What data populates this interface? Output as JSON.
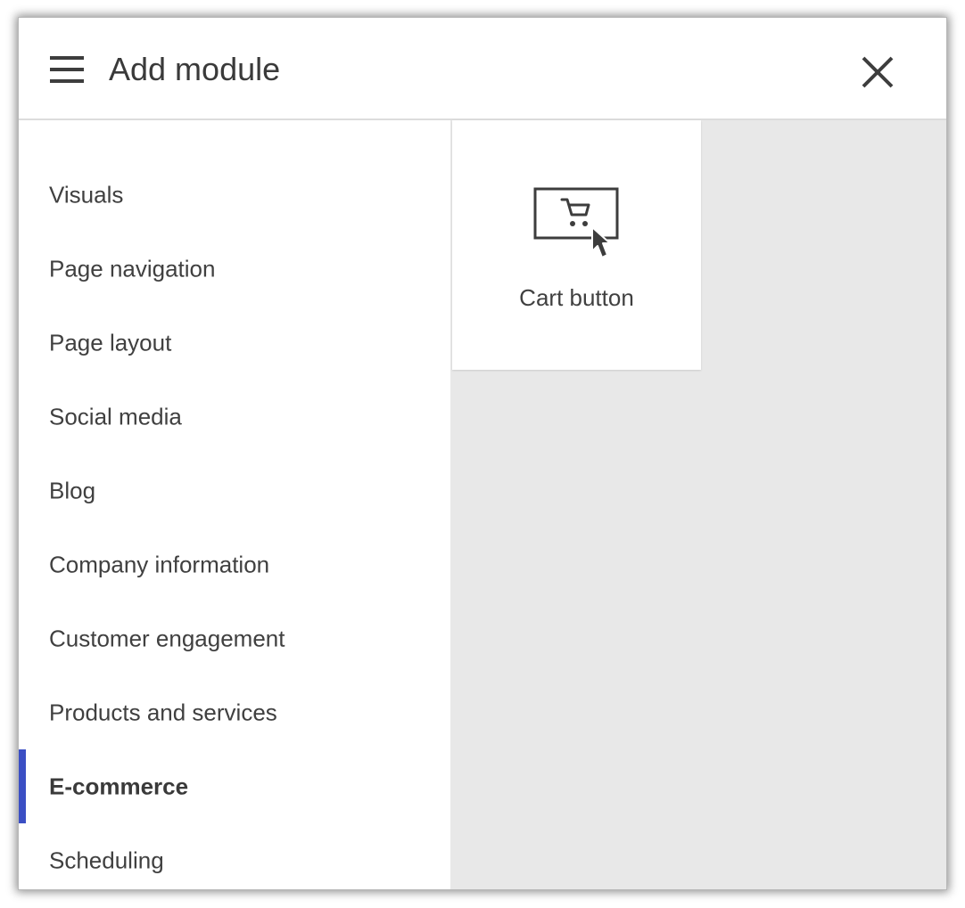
{
  "dialog": {
    "title": "Add module",
    "menu_icon": "hamburger-menu-icon",
    "close_icon": "close-icon"
  },
  "sidebar": {
    "items": [
      {
        "label": "Visuals",
        "active": false
      },
      {
        "label": "Page navigation",
        "active": false
      },
      {
        "label": "Page layout",
        "active": false
      },
      {
        "label": "Social media",
        "active": false
      },
      {
        "label": "Blog",
        "active": false
      },
      {
        "label": "Company information",
        "active": false
      },
      {
        "label": "Customer engagement",
        "active": false
      },
      {
        "label": "Products and services",
        "active": false
      },
      {
        "label": "E-commerce",
        "active": true
      },
      {
        "label": "Scheduling",
        "active": false
      }
    ]
  },
  "modules": [
    {
      "label": "Cart button",
      "icon": "cart-button-icon"
    }
  ],
  "colors": {
    "accent": "#3b4fc4",
    "content_background": "#e8e8e8",
    "text": "#404040"
  }
}
